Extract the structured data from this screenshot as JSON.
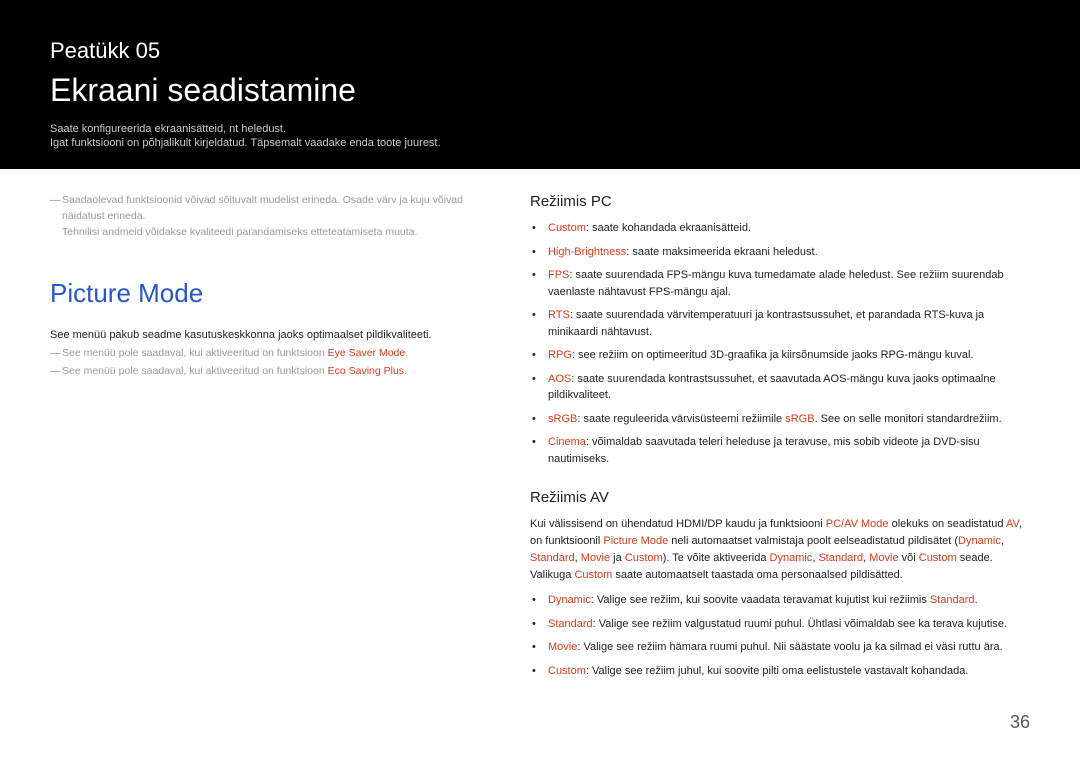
{
  "header": {
    "chapter": "Peatükk 05",
    "title": "Ekraani seadistamine",
    "intro1": "Saate konfigureerida ekraanisätteid, nt heledust.",
    "intro2": "Igat funktsiooni on põhjalikult kirjeldatud. Täpsemalt vaadake enda toote juurest."
  },
  "left": {
    "note1a": "Saadaolevad funktsioonid võivad sõltuvalt mudelist erineda. Osade värv ja kuju võivad näidatust erineda.",
    "note1b": "Tehnilisi andmeid võidakse kvaliteedi parandamiseks etteteatamiseta muuta.",
    "section_title": "Picture Mode",
    "p1": "See menüü pakub seadme kasutuskeskkonna jaoks optimaalset pildikvaliteeti.",
    "n2_pre": "See menüü pole saadaval, kui aktiveeritud on funktsioon ",
    "n2_hw": "Eye Saver Mode",
    "n2_post": ".",
    "n3_pre": "See menüü pole saadaval, kui aktiveeritud on funktsioon ",
    "n3_hw": "Eco Saving Plus",
    "n3_post": "."
  },
  "pc": {
    "heading": "Režiimis PC",
    "items": [
      {
        "hw": "Custom",
        "post": ": saate kohandada ekraanisätteid."
      },
      {
        "hw": "High-Brightness",
        "post": ": saate maksimeerida ekraani heledust."
      },
      {
        "hw": "FPS",
        "post": ": saate suurendada FPS-mängu kuva tumedamate alade heledust. See režiim suurendab vaenlaste nähtavust FPS-mängu ajal."
      },
      {
        "hw": "RTS",
        "post": ": saate suurendada värvitemperatuuri ja kontrastsussuhet, et parandada RTS-kuva ja minikaardi nähtavust."
      },
      {
        "hw": "RPG",
        "post": ": see režiim on optimeeritud 3D-graafika ja kiirsõnumside jaoks RPG-mängu kuval."
      },
      {
        "hw": "AOS",
        "post": ": saate suurendada kontrastsussuhet, et saavutada AOS-mängu kuva jaoks optimaalne pildikvaliteet."
      },
      {
        "hw_inline": true,
        "pre": "",
        "hw": "sRGB",
        "mid": ": saate reguleerida värvisüsteemi režiimile ",
        "hw2": "sRGB",
        "post": ". See on selle monitori standardrežiim."
      },
      {
        "hw": "Cinema",
        "post": ": võimaldab saavutada teleri heleduse ja teravuse, mis sobib videote ja DVD-sisu nautimiseks."
      }
    ]
  },
  "av": {
    "heading": "Režiimis AV",
    "p_pre": "Kui välissisend on ühendatud HDMI/DP kaudu ja funktsiooni ",
    "p_hw1": "PC/AV Mode",
    "p_mid1": " olekuks on seadistatud ",
    "p_hw2": "AV",
    "p_mid2": ", on funktsioonil ",
    "p_hw3": "Picture Mode",
    "p_mid3": " neli automaatset valmistaja poolt eelseadistatud pildisätet (",
    "p_hw4": "Dynamic",
    "p_c1": ", ",
    "p_hw5": "Standard",
    "p_c2": ", ",
    "p_hw6": "Movie",
    "p_mid4": " ja ",
    "p_hw7": "Custom",
    "p_mid5": "). Te võite aktiveerida ",
    "p_hw8": "Dynamic",
    "p_c3": ", ",
    "p_hw9": "Standard",
    "p_c4": ", ",
    "p_hw10": "Movie",
    "p_mid6": " või ",
    "p_hw11": "Custom",
    "p_mid7": " seade. Valikuga ",
    "p_hw12": "Custom",
    "p_post": " saate automaatselt taastada oma personaalsed pildisätted.",
    "items": [
      {
        "hw": "Dynamic",
        "mid": ": Valige see režiim, kui soovite vaadata teravamat kujutist kui režiimis ",
        "hw2": "Standard",
        "post": "."
      },
      {
        "hw": "Standard",
        "post": ": Valige see režiim valgustatud ruumi puhul. Ühtlasi võimaldab see ka terava kujutise."
      },
      {
        "hw": "Movie",
        "post": ": Valige see režiim hämara ruumi puhul. Nii säästate voolu ja ka silmad ei väsi ruttu ära."
      },
      {
        "hw": "Custom",
        "post": ": Valige see režiim juhul, kui soovite pilti oma eelistustele vastavalt kohandada."
      }
    ]
  },
  "page_number": "36"
}
